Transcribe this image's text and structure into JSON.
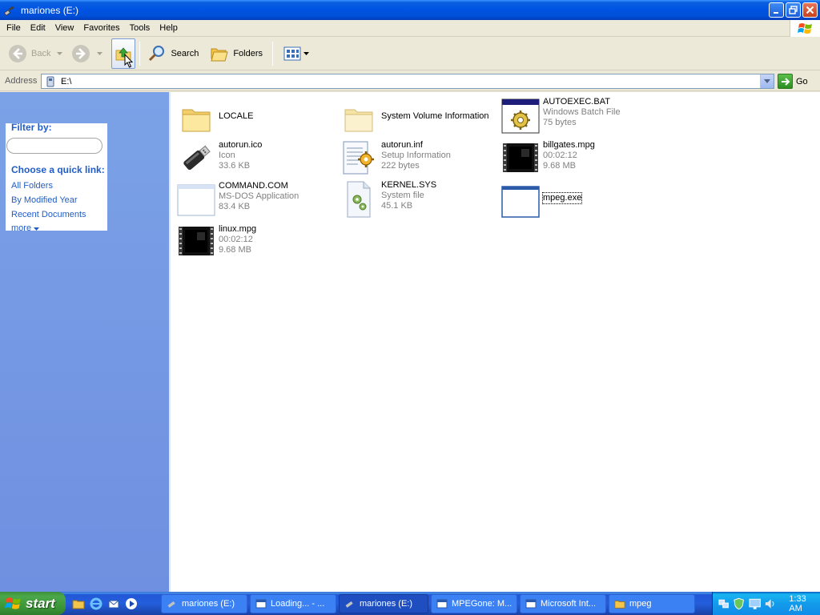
{
  "window": {
    "title": "mariones (E:)"
  },
  "menu": {
    "items": [
      "File",
      "Edit",
      "View",
      "Favorites",
      "Tools",
      "Help"
    ]
  },
  "toolbar": {
    "back_label": "Back",
    "search_label": "Search",
    "folders_label": "Folders"
  },
  "address": {
    "label": "Address",
    "value": "E:\\",
    "go_label": "Go"
  },
  "taskpane": {
    "filter_title": "Filter by:",
    "quick_links_title": "Choose a quick link:",
    "links": [
      "All Folders",
      "By Modified Year",
      "Recent Documents"
    ],
    "more_label": "more"
  },
  "files": [
    {
      "name": "LOCALE",
      "sub1": "",
      "sub2": "",
      "icon": "folder-icon"
    },
    {
      "name": "System Volume Information",
      "sub1": "",
      "sub2": "",
      "icon": "folder-icon"
    },
    {
      "name": "AUTOEXEC.BAT",
      "sub1": "Windows Batch File",
      "sub2": "75 bytes",
      "icon": "batch-file-icon"
    },
    {
      "name": "autorun.ico",
      "sub1": "Icon",
      "sub2": "33.6 KB",
      "icon": "usb-drive-icon"
    },
    {
      "name": "autorun.inf",
      "sub1": "Setup Information",
      "sub2": "222 bytes",
      "icon": "setup-info-icon"
    },
    {
      "name": "billgates.mpg",
      "sub1": "00:02:12",
      "sub2": "9.68 MB",
      "icon": "video-file-icon"
    },
    {
      "name": "COMMAND.COM",
      "sub1": "MS-DOS Application",
      "sub2": "83.4 KB",
      "icon": "application-icon"
    },
    {
      "name": "KERNEL.SYS",
      "sub1": "System file",
      "sub2": "45.1 KB",
      "icon": "system-file-icon"
    },
    {
      "name": "mpeg.exe",
      "sub1": "",
      "sub2": "",
      "icon": "application-icon"
    },
    {
      "name": "linux.mpg",
      "sub1": "00:02:12",
      "sub2": "9.68 MB",
      "icon": "video-file-icon"
    }
  ],
  "taskbar": {
    "start_label": "start",
    "tasks": [
      {
        "label": "mariones (E:)",
        "active": false
      },
      {
        "label": "Loading... - ...",
        "active": false
      },
      {
        "label": "mariones (E:)",
        "active": true
      },
      {
        "label": "MPEGone: M...",
        "active": false
      },
      {
        "label": "Microsoft Int...",
        "active": false
      },
      {
        "label": "mpeg",
        "active": false
      }
    ],
    "clock": "1:33 AM"
  }
}
